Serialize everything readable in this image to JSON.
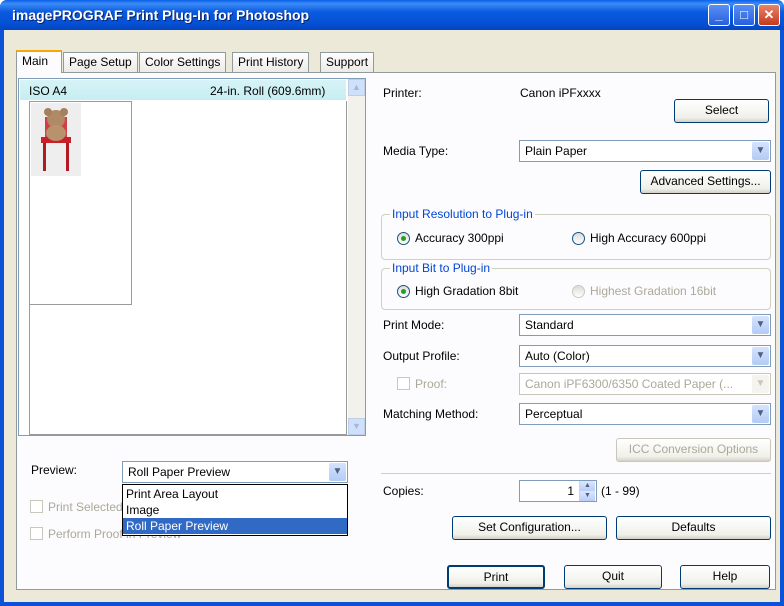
{
  "window": {
    "title": "imagePROGRAF Print Plug-In for Photoshop"
  },
  "title_buttons": {
    "minimize": "_",
    "maximize": "□",
    "close": "✕"
  },
  "tabs": [
    "Main",
    "Page Setup",
    "Color Settings",
    "Print History",
    "Support"
  ],
  "preview_area": {
    "paper_name": "ISO A4",
    "roll_size": "24-in. Roll (609.6mm)"
  },
  "preview_section": {
    "label": "Preview:",
    "selected": "Roll Paper Preview",
    "options": [
      "Print Area Layout",
      "Image",
      "Roll Paper Preview"
    ],
    "print_selected_label": "Print Selected",
    "perform_proof_label": "Perform Proof in Preview"
  },
  "printer": {
    "label": "Printer:",
    "value": "Canon iPFxxxx",
    "select_button": "Select"
  },
  "media_type": {
    "label": "Media Type:",
    "value": "Plain Paper",
    "advanced_button": "Advanced Settings..."
  },
  "input_resolution": {
    "group_label": "Input Resolution to Plug-in",
    "option1": "Accuracy 300ppi",
    "option2": "High Accuracy 600ppi"
  },
  "input_bit": {
    "group_label": "Input Bit to Plug-in",
    "option1": "High Gradation 8bit",
    "option2": "Highest Gradation 16bit"
  },
  "print_mode": {
    "label": "Print Mode:",
    "value": "Standard"
  },
  "output_profile": {
    "label": "Output Profile:",
    "value": "Auto (Color)"
  },
  "proof": {
    "label": "Proof:",
    "value": "Canon iPF6300/6350 Coated Paper (..."
  },
  "matching_method": {
    "label": "Matching Method:",
    "value": "Perceptual"
  },
  "icc_button": "ICC Conversion Options",
  "copies": {
    "label": "Copies:",
    "value": "1",
    "range": "(1 - 99)"
  },
  "set_configuration_button": "Set Configuration...",
  "defaults_button": "Defaults",
  "bottom_buttons": {
    "print": "Print",
    "quit": "Quit",
    "help": "Help"
  },
  "colors": {
    "title_bar": "#0a5ae0",
    "dialog_bg": "#ece9d8",
    "selection": "#316ac5",
    "group_label": "#0046d5"
  }
}
